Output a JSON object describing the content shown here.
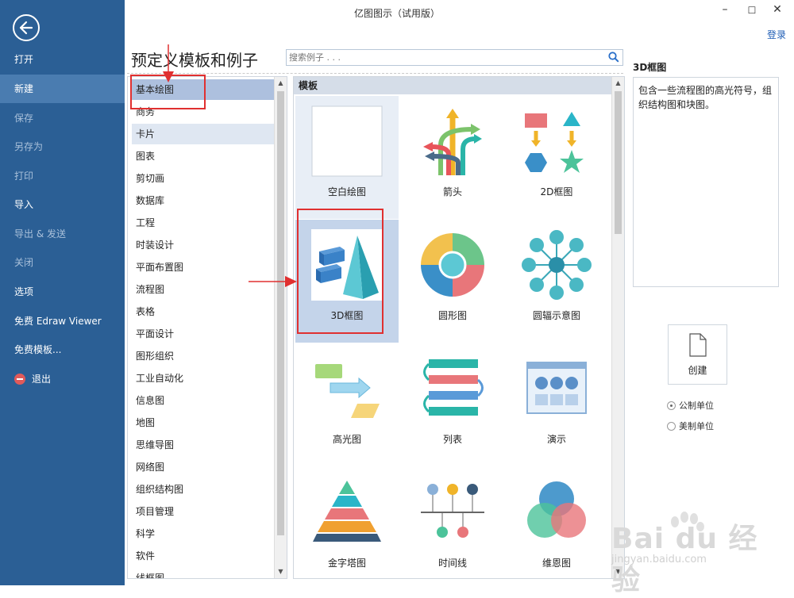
{
  "window": {
    "title": "亿图图示（试用版）",
    "login": "登录"
  },
  "sidebar": {
    "items": [
      {
        "label": "打开"
      },
      {
        "label": "新建"
      },
      {
        "label": "保存"
      },
      {
        "label": "另存为"
      },
      {
        "label": "打印"
      },
      {
        "label": "导入"
      },
      {
        "label": "导出 & 发送"
      },
      {
        "label": "关闭"
      },
      {
        "label": "选项"
      },
      {
        "label": "免费 Edraw Viewer"
      },
      {
        "label": "免费模板..."
      },
      {
        "label": "退出"
      }
    ]
  },
  "main": {
    "heading": "预定义模板和例子",
    "search_placeholder": "搜索例子 . . ."
  },
  "categories": [
    "基本绘图",
    "商务",
    "卡片",
    "图表",
    "剪切画",
    "数据库",
    "工程",
    "时装设计",
    "平面布置图",
    "流程图",
    "表格",
    "平面设计",
    "图形组织",
    "工业自动化",
    "信息图",
    "地图",
    "思维导图",
    "网络图",
    "组织结构图",
    "项目管理",
    "科学",
    "软件",
    "线框图"
  ],
  "templates": {
    "header": "模板",
    "items": [
      {
        "label": "空白绘图"
      },
      {
        "label": "箭头"
      },
      {
        "label": "2D框图"
      },
      {
        "label": "3D框图"
      },
      {
        "label": "圆形图"
      },
      {
        "label": "圆辐示意图"
      },
      {
        "label": "高光图"
      },
      {
        "label": "列表"
      },
      {
        "label": "演示"
      },
      {
        "label": "金字塔图"
      },
      {
        "label": "时间线"
      },
      {
        "label": "维恩图"
      }
    ]
  },
  "details": {
    "title": "3D框图",
    "description": "包含一些流程图的高光符号，组织结构图和块图。",
    "create_label": "创建",
    "unit_metric": "公制单位",
    "unit_imperial": "美制单位"
  },
  "watermark": {
    "brand": "Bai du 经验",
    "url": "jingyan.baidu.com"
  },
  "colors": {
    "sidebar": "#2b5f95",
    "sidebar_active": "#4a7cb0",
    "selection": "#adc0de",
    "annotation": "#e03030"
  }
}
